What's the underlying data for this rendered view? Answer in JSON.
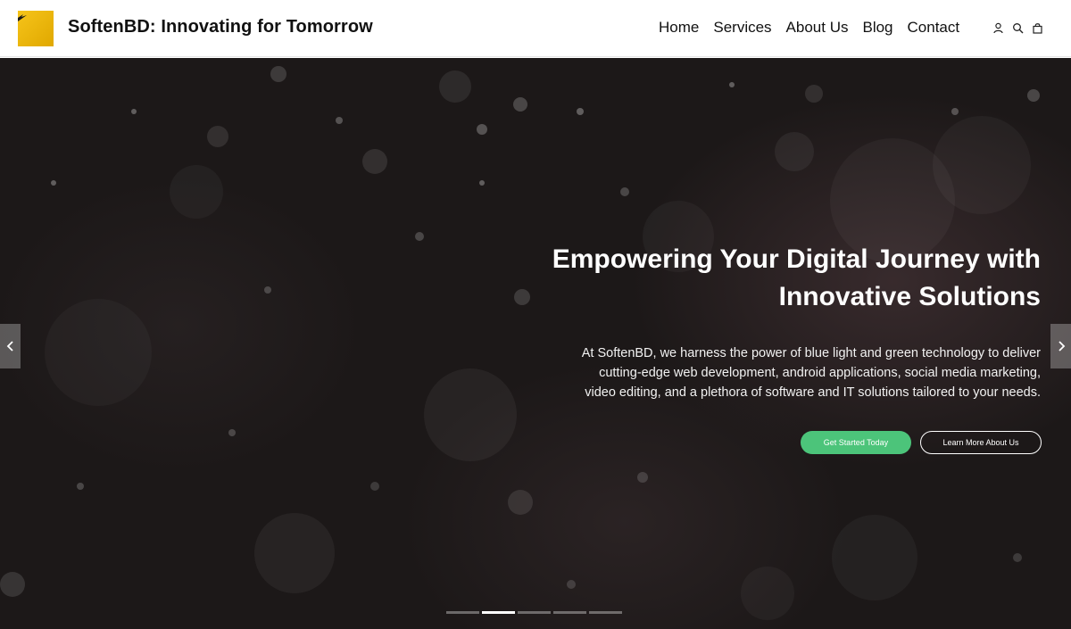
{
  "header": {
    "brand": "SoftenBD: Innovating for Tomorrow",
    "nav": [
      "Home",
      "Services",
      "About Us",
      "Blog",
      "Contact"
    ],
    "icons": [
      "user-icon",
      "search-icon",
      "cart-icon"
    ]
  },
  "hero": {
    "title_line1": "Empowering Your Digital Journey with",
    "title_line2": "Innovative Solutions",
    "text_line1": "At SoftenBD, we harness the power of blue light and green technology to deliver",
    "text_line2": "cutting-edge web development, android applications, social media marketing,",
    "text_line3": "video editing, and a plethora of software and IT solutions tailored to your needs.",
    "primary_button": "Get Started Today",
    "secondary_button": "Learn More About Us",
    "slide_count": 5,
    "active_slide": 2
  },
  "colors": {
    "accent": "#4cc47a",
    "logo": "#f6c41a",
    "hero_bg": "#1c1818"
  }
}
